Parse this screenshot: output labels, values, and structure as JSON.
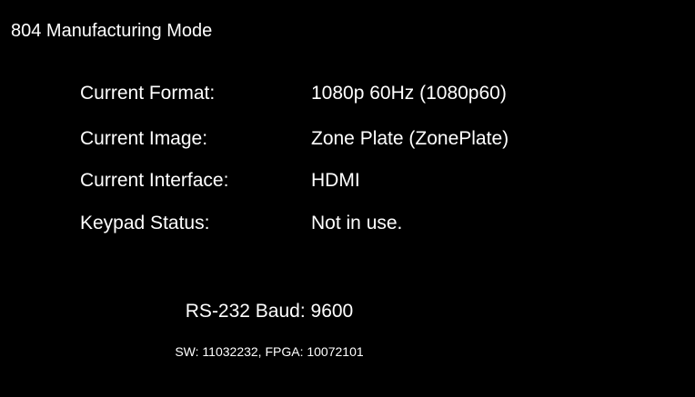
{
  "header": {
    "title": "804 Manufacturing Mode"
  },
  "status": {
    "rows": [
      {
        "label": "Current Format:",
        "value": "1080p 60Hz (1080p60)"
      },
      {
        "label": "Current Image:",
        "value": "Zone Plate (ZonePlate)"
      },
      {
        "label": "Current Interface:",
        "value": "HDMI"
      },
      {
        "label": "Keypad Status:",
        "value": "Not in use."
      }
    ]
  },
  "footer": {
    "baud": "RS-232 Baud: 9600",
    "version": "SW: 11032232, FPGA: 10072101"
  },
  "colors": {
    "background": "#000000",
    "text": "#ffffff"
  }
}
